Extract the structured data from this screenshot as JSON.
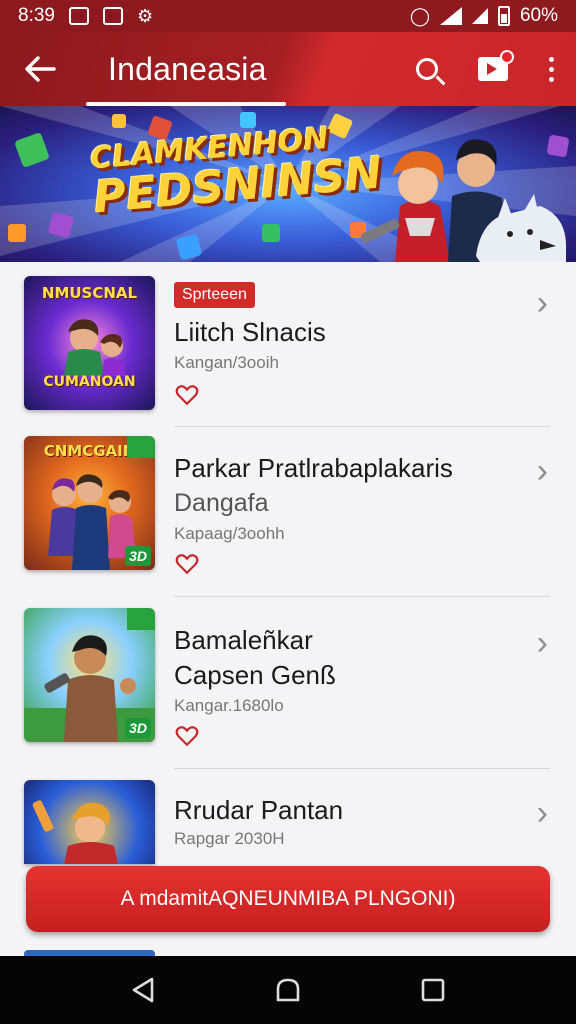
{
  "status_bar": {
    "time": "8:39",
    "battery": "60%"
  },
  "app_bar": {
    "title": "Indaneasia"
  },
  "banner": {
    "title_line1": "CLAMKENHON",
    "title_line2": "PEDSNINSN"
  },
  "items": [
    {
      "tag": "Sprteeen",
      "title": "Liitch Slnacis",
      "subtitle": "",
      "meta": "Kangan/3ooih",
      "thumb_text_top": "NMUSCNAL",
      "thumb_text_bottom": "CUMANOAN"
    },
    {
      "tag": "",
      "title": "Parkar Pratlrabaplakaris",
      "subtitle": "Dangafa",
      "meta": "Kapaag/3oohh",
      "thumb_text_top": "CNMCGAIN",
      "thumb_badge": "3D"
    },
    {
      "tag": "",
      "title": "Bamaleñkar",
      "subtitle": "Capsen Genß",
      "meta": "Kangar.1680lo",
      "thumb_badge": "3D"
    },
    {
      "tag": "",
      "title": "Rrudar Pantan",
      "subtitle": "",
      "meta": "Rapgar 2030H"
    }
  ],
  "cta": {
    "label": "A mdamitAQNEUNMIBA PLNGONI)"
  },
  "colors": {
    "primary": "#c8262a",
    "dark_primary": "#8b1a1e",
    "accent_tag": "#d42a2a",
    "heart": "#c8262a"
  },
  "icons": [
    "back-arrow-icon",
    "search-icon",
    "inbox-play-icon",
    "more-vert-icon",
    "heart-outline-icon",
    "chevron-right-icon",
    "nav-back-icon",
    "nav-home-icon",
    "nav-recents-icon"
  ]
}
